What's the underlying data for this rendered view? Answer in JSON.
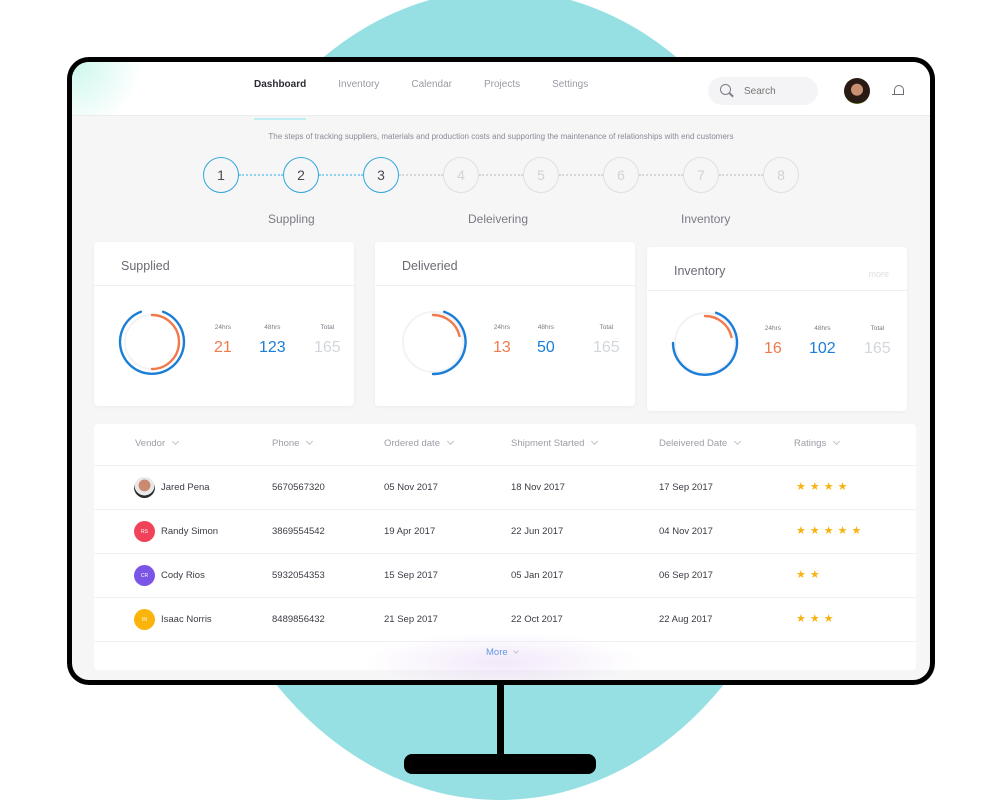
{
  "nav": {
    "items": [
      {
        "label": "Dashboard",
        "active": true
      },
      {
        "label": "Inventory",
        "active": false
      },
      {
        "label": "Calendar",
        "active": false
      },
      {
        "label": "Projects",
        "active": false
      },
      {
        "label": "Settings",
        "active": false
      }
    ],
    "search_placeholder": "Search"
  },
  "tracker": {
    "subtitle": "The steps of tracking suppliers, materials and production costs and supporting the maintenance of relationships with end customers",
    "steps": [
      "1",
      "2",
      "3",
      "4",
      "5",
      "6",
      "7",
      "8"
    ],
    "completed_steps": 3,
    "stage_labels": [
      "Suppling",
      "Deleivering",
      "Inventory"
    ]
  },
  "cards": [
    {
      "title": "Supplied",
      "more": "",
      "labels": [
        "24hrs",
        "48hrs",
        "Total"
      ],
      "h24": "21",
      "h48": "123",
      "total": "165"
    },
    {
      "title": "Deliveried",
      "more": "",
      "labels": [
        "24hrs",
        "48hrs",
        "Total"
      ],
      "h24": "13",
      "h48": "50",
      "total": "165"
    },
    {
      "title": "Inventory",
      "more": "more",
      "labels": [
        "24hrs",
        "48hrs",
        "Total"
      ],
      "h24": "16",
      "h48": "102",
      "total": "165"
    }
  ],
  "table": {
    "headers": [
      "Vendor",
      "Phone",
      "Ordered date",
      "Shipment Started",
      "Deleivered Date",
      "Ratings"
    ],
    "rows": [
      {
        "vendor": "Jared Pena",
        "initials": "",
        "avatar_color": "#6b6b6b",
        "phone": "5670567320",
        "ordered": "05 Nov 2017",
        "shipment": "18 Nov 2017",
        "delivered": "17 Sep 2017",
        "rating": 4,
        "stars": "★★★★"
      },
      {
        "vendor": "Randy Simon",
        "initials": "RS",
        "avatar_color": "#f0435a",
        "phone": "3869554542",
        "ordered": "19 Apr 2017",
        "shipment": "22 Jun 2017",
        "delivered": "04 Nov 2017",
        "rating": 5,
        "stars": "★★★★★"
      },
      {
        "vendor": "Cody Rios",
        "initials": "CR",
        "avatar_color": "#7a55e6",
        "phone": "5932054353",
        "ordered": "15 Sep 2017",
        "shipment": "05 Jan 2017",
        "delivered": "06 Sep 2017",
        "rating": 2,
        "stars": "★★"
      },
      {
        "vendor": "Isaac Norris",
        "initials": "IN",
        "avatar_color": "#fbb40a",
        "phone": "8489856432",
        "ordered": "21 Sep 2017",
        "shipment": "22 Oct 2017",
        "delivered": "22 Aug 2017",
        "rating": 3,
        "stars": "★★★"
      }
    ],
    "more_label": "More"
  },
  "colors": {
    "accent_blue": "#1a7ed8",
    "accent_orange": "#f07a4c",
    "star": "#f6b312",
    "backdrop": "#96e0e3"
  }
}
